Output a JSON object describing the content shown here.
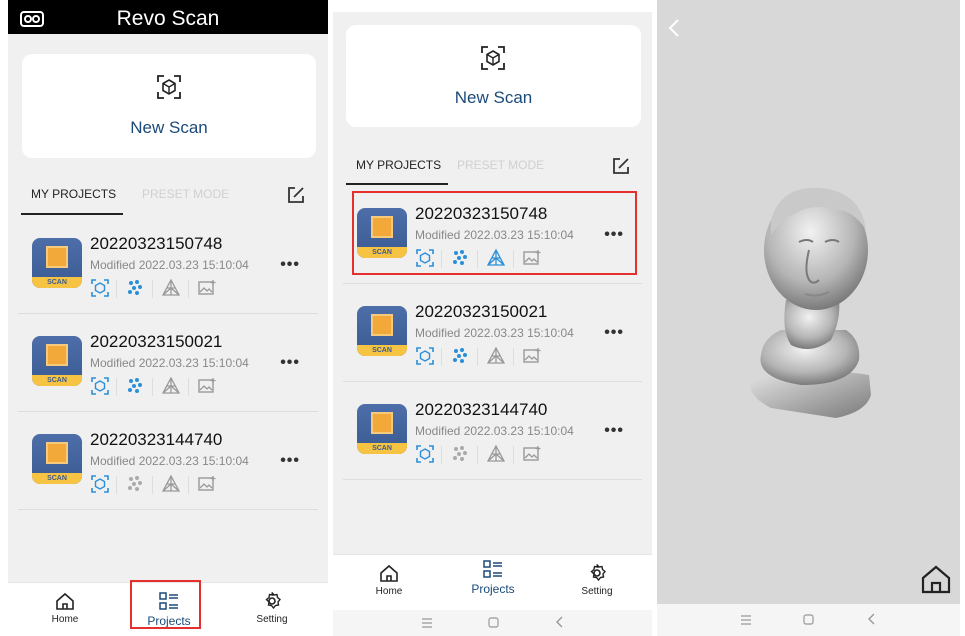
{
  "app_title": "Revo Scan",
  "new_scan_label": "New Scan",
  "tabs": {
    "my_projects": "MY PROJECTS",
    "preset_mode": "PRESET MODE"
  },
  "projects": [
    {
      "name": "20220323150748",
      "modified": "Modified 2022.03.23 15:10:04"
    },
    {
      "name": "20220323150021",
      "modified": "Modified 2022.03.23 15:10:04"
    },
    {
      "name": "20220323144740",
      "modified": "Modified 2022.03.23 15:10:04"
    }
  ],
  "app_icon_label": "SCAN",
  "more_label": "•••",
  "nav": {
    "home": "Home",
    "projects": "Projects",
    "setting": "Setting"
  },
  "colors": {
    "accent": "#1b4a7a",
    "highlight": "#e53030",
    "blue_icon": "#2a8fd8"
  }
}
